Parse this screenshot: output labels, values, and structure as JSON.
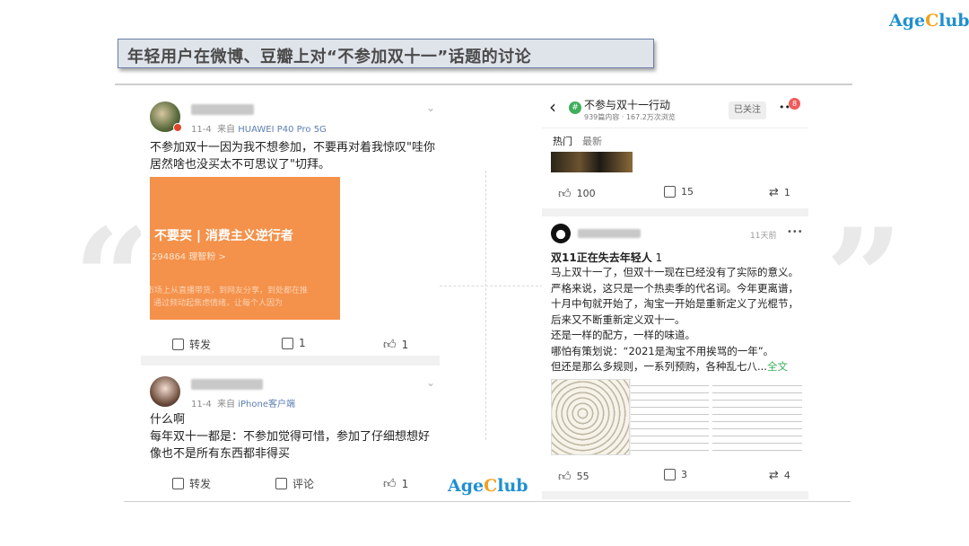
{
  "brand": {
    "age": "Age",
    "c": "C",
    "lub": "lub"
  },
  "slide_title": "年轻用户在微博、豆瓣上对“不参加双十一”话题的讨论",
  "colors": {
    "brand_blue": "#1f8fd1",
    "brand_gold": "#f0a21b",
    "orange_card": "#f4914a",
    "link_green": "#3eaf5a"
  },
  "left_posts": [
    {
      "meta_date": "11-4",
      "meta_from": "来自",
      "meta_device": "HUAWEI P40 Pro 5G",
      "text_lines": [
        "不参加双十一因为我不想参加，不要再对着我惊叹\"哇你",
        "居然啥也没买太不可思议了\"切拜。"
      ],
      "image": {
        "heading": "不要买 | 消费主义逆行者",
        "sub": "294864 理智粉 >",
        "line1": "市场上从直播带货，到网友分享，到处都在推",
        "line2": "通过频动起焦虑情绪，让每个人因为"
      },
      "actions": {
        "share": "转发",
        "comment": "1",
        "like": "1"
      }
    },
    {
      "meta_date": "11-4",
      "meta_from": "来自",
      "meta_device": "iPhone客户端",
      "text_lines": [
        "什么啊",
        "每年双十一都是：不参加觉得可惜，参加了仔细想想好",
        "像也不是所有东西都非得买"
      ],
      "actions": {
        "share": "转发",
        "comment": "评论",
        "like": "1"
      }
    }
  ],
  "right_panel": {
    "header": {
      "title": "不参与双十一行动",
      "stats": "939篇内容 · 167.2万次浏览",
      "follow_button": "已关注",
      "more": "••",
      "badge": "8"
    },
    "tabs": [
      "热门",
      "最新"
    ],
    "post1": {
      "likes": "100",
      "comments": "15",
      "reposts": "1"
    },
    "post2": {
      "time": "11天前",
      "more": "•••",
      "title": "双11正在失去年轻人",
      "title_count": "1",
      "lines": [
        "马上双十一了，但双十一现在已经没有了实际的意义。",
        "严格来说，这只是一个热卖季的代名词。今年更离谱，",
        "十月中旬就开始了，淘宝一开始是重新定义了光棍节，",
        "后来又不断重新定义双十一。",
        "还是一样的配方，一样的味道。",
        "哪怕有策划说：“2021是淘宝不用挨骂的一年”。",
        "但还是那么多规则，一系列预购，各种乱七八..."
      ],
      "full_text": "全文",
      "likes": "55",
      "comments": "3",
      "reposts": "4"
    }
  },
  "watermark": {
    "age": "Age",
    "c": "C",
    "lub": "lub"
  }
}
